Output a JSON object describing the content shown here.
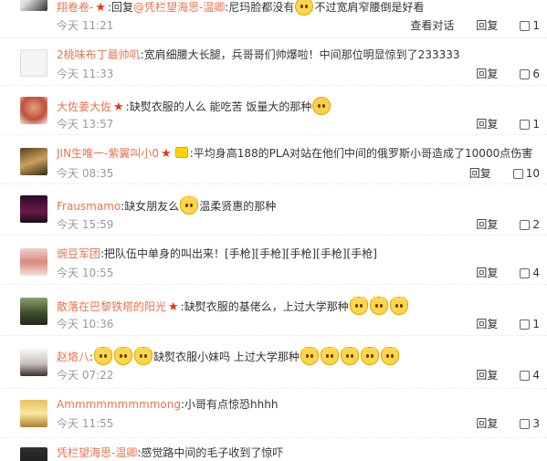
{
  "labels": {
    "reply": "回复",
    "view_conversation": "查看对话"
  },
  "comments": [
    {
      "user": "翔卷卷-",
      "parts": [
        ":回复",
        "@凭栏望海思-温卿",
        ":尼玛脸都没有",
        "不过宽肩窄腰倒是好看"
      ],
      "time": "今天 11:21",
      "likes": "1"
    },
    {
      "user": "2桃味布丁最帅叽",
      "parts": [
        ":宽肩细腰大长腿，兵哥哥们帅爆啦！中间那位明显惊到了233333"
      ],
      "time": "今天 11:33",
      "likes": "6"
    },
    {
      "user": "大佐姜大佐",
      "parts": [
        ":缺熨衣服的人么 能吃苦 饭量大的那种"
      ],
      "time": "今天 13:57",
      "likes": "1"
    },
    {
      "user": "JIN生唯一-紫翼叫小0",
      "parts": [
        ":平均身高188的PLA对站在他们中间的俄罗斯小哥造成了10000点伤害"
      ],
      "time": "今天 08:35",
      "likes": "10"
    },
    {
      "user": "Frausmamo",
      "parts": [
        ":缺女朋友么",
        "温柔贤惠的那种"
      ],
      "time": "今天 15:59",
      "likes": "2"
    },
    {
      "user": "豌豆军团",
      "parts": [
        ":把队伍中单身的叫出来！[手枪][手枪][手枪][手枪][手枪]"
      ],
      "time": "今天 10:55",
      "likes": "4"
    },
    {
      "user": "散落在巴黎铁塔的阳光",
      "parts": [
        ":缺熨衣服的基佬么，上过大学那种"
      ],
      "time": "今天 10:36",
      "likes": "1"
    },
    {
      "user": "赵烙八",
      "parts": [
        ":",
        "缺熨衣服小妹吗 上过大学那种"
      ],
      "time": "今天 07:22",
      "likes": "4"
    },
    {
      "user": "Ammmmmmmmmong",
      "parts": [
        ":小哥有点惊恐hhhh"
      ],
      "time": "今天 11:55",
      "likes": "3"
    },
    {
      "user": "凭栏望海思-温卿",
      "parts": [
        ":感觉路中间的毛子收到了惊吓"
      ],
      "time": "",
      "likes": ""
    }
  ]
}
